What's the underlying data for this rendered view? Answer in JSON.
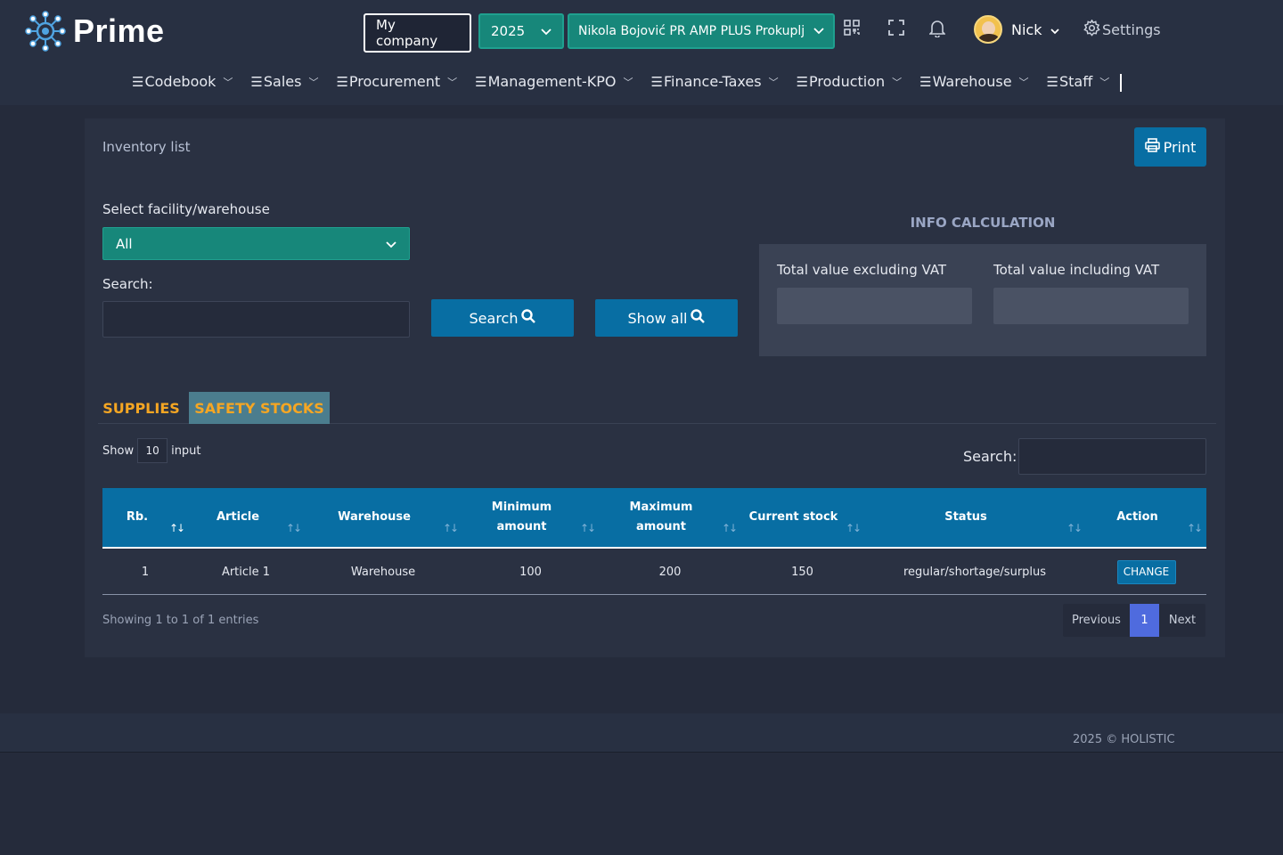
{
  "header": {
    "brand": "Prime",
    "company_button": "My company",
    "year": "2025",
    "firm": "Nikola Bojović PR AMP PLUS Prokuplj",
    "user_name": "Nick",
    "settings_label": "Settings",
    "icons": [
      "qr-code-icon",
      "fullscreen-icon",
      "bell-icon",
      "gear-icon"
    ]
  },
  "nav": {
    "items": [
      {
        "label": "Codebook"
      },
      {
        "label": "Sales"
      },
      {
        "label": "Procurement"
      },
      {
        "label": "Management-KPO"
      },
      {
        "label": "Finance-Taxes"
      },
      {
        "label": "Production"
      },
      {
        "label": "Warehouse"
      },
      {
        "label": "Staff"
      }
    ]
  },
  "page": {
    "title": "Inventory list",
    "print_label": "Print",
    "facility_label": "Select facility/warehouse",
    "facility_value": "All",
    "search_label": "Search:",
    "search_value": "",
    "search_button": "Search",
    "show_all_button": "Show all"
  },
  "info": {
    "title": "INFO CALCULATION",
    "excl_label": "Total value excluding VAT",
    "incl_label": "Total value including VAT",
    "excl_value": "",
    "incl_value": ""
  },
  "tabs": [
    {
      "label": "SUPPLIES",
      "active": false
    },
    {
      "label": "SAFETY STOCKS",
      "active": true
    }
  ],
  "table": {
    "show_label": "Show",
    "page_size": "10",
    "input_label": "input",
    "search_label": "Search:",
    "columns": [
      {
        "label": "Rb."
      },
      {
        "label": "Article"
      },
      {
        "label": "Warehouse"
      },
      {
        "line1": "Minimum",
        "line2": "amount"
      },
      {
        "line1": "Maximum",
        "line2": "amount"
      },
      {
        "label": "Current stock"
      },
      {
        "label": "Status"
      },
      {
        "label": "Action"
      }
    ],
    "rows": [
      {
        "rb": "1",
        "article": "Article 1",
        "warehouse": "Warehouse",
        "min": "100",
        "max": "200",
        "current": "150",
        "status": "regular/shortage/surplus",
        "action": "CHANGE"
      }
    ],
    "showing_text": "Showing 1 to 1 of 1 entries",
    "pagination": {
      "previous": "Previous",
      "page": "1",
      "next": "Next"
    }
  },
  "footer": {
    "copyright": "2025 © HOLISTIC"
  },
  "colors": {
    "background": "#252b3b",
    "header": "#283042",
    "teal": "#17877a",
    "blue": "#086ea3",
    "tab_orange": "#f5a623",
    "active_tab": "#4b7d8e",
    "page_active": "#4f6bde"
  }
}
